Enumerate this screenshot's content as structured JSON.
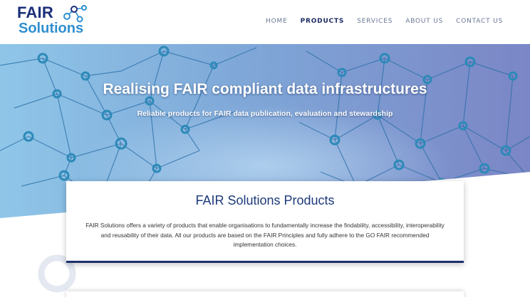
{
  "header": {
    "logo_line1": "FAIR",
    "logo_line2": "Solutions",
    "nav": [
      {
        "label": "HOME",
        "active": false
      },
      {
        "label": "PRODUCTS",
        "active": true
      },
      {
        "label": "SERVICES",
        "active": false
      },
      {
        "label": "ABOUT US",
        "active": false
      },
      {
        "label": "CONTACT US",
        "active": false
      }
    ]
  },
  "hero": {
    "title": "Realising FAIR compliant data infrastructures",
    "subtitle": "Reliable products for FAIR data publication, evaluation and stewardship"
  },
  "products": {
    "title": "FAIR Solutions Products",
    "description": "FAIR Solutions offers a variety of products that enable organisations to fundamentally increase the findability, accessibility, interoperability and reusability of their data. All our products are based on the FAIR Principles and fully adhere to the GO FAIR recommended implementation choices."
  },
  "colors": {
    "brand_dark": "#1b2f7a",
    "brand_light": "#2f8fcf",
    "nav_active": "#1d2c63",
    "nav_inactive": "#6a7696"
  }
}
